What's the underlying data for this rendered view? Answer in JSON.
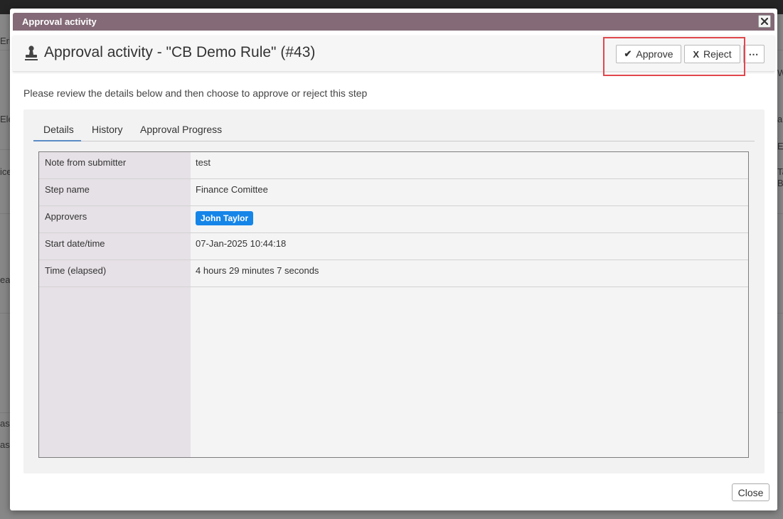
{
  "modal": {
    "title": "Approval activity",
    "header_title": "Approval activity - \"CB Demo Rule\" (#43)",
    "approve_label": "Approve",
    "reject_label": "Reject",
    "more_label": "⋯",
    "approve_glyph": "✔",
    "reject_glyph": "X",
    "intro": "Please review the details below and then choose to approve or reject this step",
    "close_label": "Close",
    "tabs": [
      {
        "label": "Details",
        "active": true
      },
      {
        "label": "History",
        "active": false
      },
      {
        "label": "Approval Progress",
        "active": false
      }
    ],
    "details": [
      {
        "label": "Note from submitter",
        "value": "test"
      },
      {
        "label": "Step name",
        "value": "Finance Comittee"
      },
      {
        "label": "Approvers",
        "value": "John Taylor"
      },
      {
        "label": "Start date/time",
        "value": "07-Jan-2025 10:44:18"
      },
      {
        "label": "Time (elapsed)",
        "value": "4 hours 29 minutes 7 seconds"
      }
    ]
  },
  "background": {
    "fragments": [
      "Eri",
      "Ele",
      "ice",
      "ead",
      "as",
      "as",
      "Ta",
      "B",
      "W",
      "a",
      "E"
    ]
  },
  "colors": {
    "titlebar": "#836a76",
    "badge": "#1585e8",
    "highlight": "#e0474c"
  },
  "icons": {
    "header": "stamp-icon",
    "close": "close-icon",
    "approve": "checkmark-icon",
    "reject": "x-icon",
    "more": "more-icon"
  }
}
